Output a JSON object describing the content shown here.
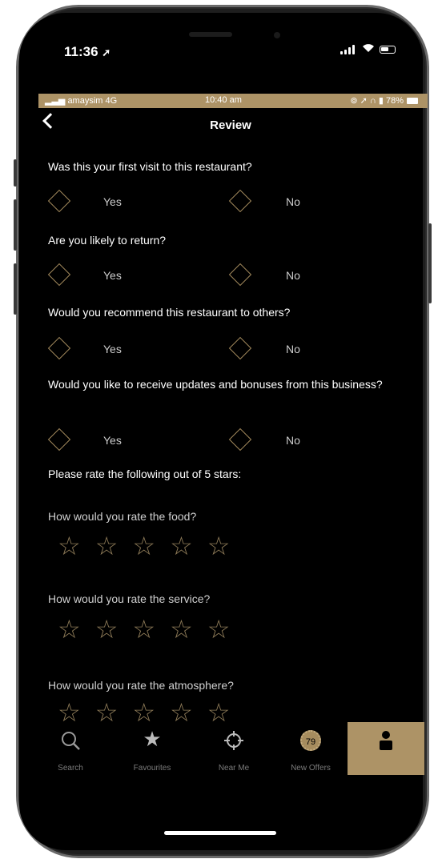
{
  "ios_status": {
    "time": "11:36"
  },
  "inner_status": {
    "carrier": "amaysim 4G",
    "time": "10:40 am",
    "battery": "78%"
  },
  "nav": {
    "title": "Review"
  },
  "questions": [
    {
      "text": "Was this your first visit to this restaurant?",
      "yes": "Yes",
      "no": "No"
    },
    {
      "text": "Are you likely to return?",
      "yes": "Yes",
      "no": "No"
    },
    {
      "text": "Would you recommend this restaurant to others?",
      "yes": "Yes",
      "no": "No"
    },
    {
      "text": "Would you like to receive updates and bonuses from this business?",
      "yes": "Yes",
      "no": "No"
    }
  ],
  "rating": {
    "heading": "Please rate the following out of 5 stars:",
    "items": [
      {
        "label": "How would you rate the food?",
        "value": 0
      },
      {
        "label": "How would you rate the service?",
        "value": 0
      },
      {
        "label": "How would you rate the atmosphere?",
        "value": 0
      }
    ],
    "max": 5
  },
  "tabs": [
    {
      "label": "Search",
      "icon": "search-icon"
    },
    {
      "label": "Favourites",
      "icon": "star-icon"
    },
    {
      "label": "Near Me",
      "icon": "crosshair-icon"
    },
    {
      "label": "New Offers",
      "icon": "offers-badge-icon",
      "badge": "79"
    },
    {
      "label": "",
      "icon": "person-icon",
      "active": true
    }
  ],
  "colors": {
    "accent": "#ad9366",
    "background": "#000000"
  }
}
